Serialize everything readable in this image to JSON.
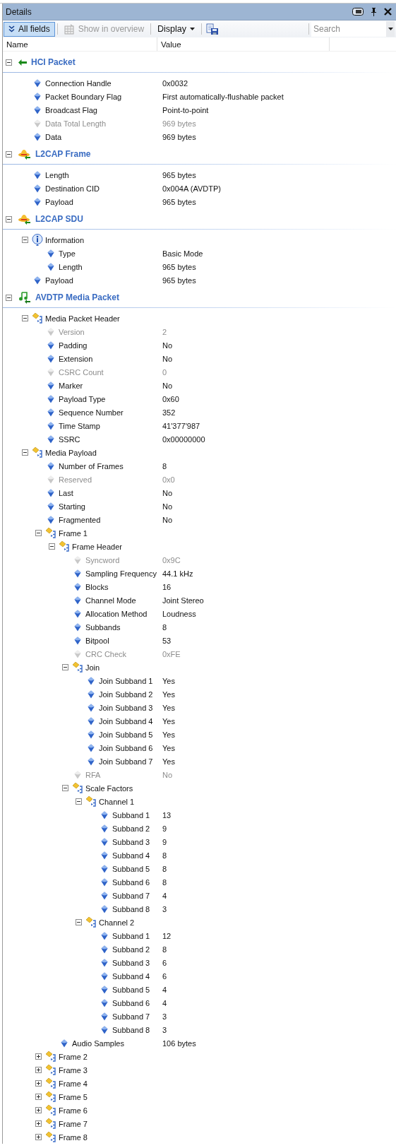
{
  "window": {
    "title": "Details"
  },
  "toolbar": {
    "all_fields": {
      "label": "All fields",
      "selected": true
    },
    "show_in_overview": {
      "label": "Show in overview",
      "disabled": true
    },
    "display": {
      "label": "Display"
    },
    "search": {
      "placeholder": "Search"
    }
  },
  "columns": [
    "Name",
    "Value"
  ],
  "sections": [
    {
      "title": "HCI Packet",
      "expanded": true,
      "children": [
        {
          "kind": "field",
          "name": "Connection Handle",
          "value": "0x0032",
          "disabled": false
        },
        {
          "kind": "field",
          "name": "Packet Boundary Flag",
          "value": "First automatically-flushable packet",
          "disabled": false
        },
        {
          "kind": "field",
          "name": "Broadcast Flag",
          "value": "Point-to-point",
          "disabled": false
        },
        {
          "kind": "field",
          "name": "Data Total Length",
          "value": "969 bytes",
          "disabled": true
        },
        {
          "kind": "field",
          "name": "Data",
          "value": "969 bytes",
          "disabled": false
        }
      ]
    },
    {
      "title": "L2CAP Frame",
      "expanded": true,
      "children": [
        {
          "kind": "field",
          "name": "Length",
          "value": "965 bytes",
          "disabled": false
        },
        {
          "kind": "field",
          "name": "Destination CID",
          "value": "0x004A (AVDTP)",
          "disabled": false
        },
        {
          "kind": "field",
          "name": "Payload",
          "value": "965 bytes",
          "disabled": false
        }
      ]
    },
    {
      "title": "L2CAP SDU",
      "expanded": true,
      "children": [
        {
          "kind": "info",
          "name": "Information",
          "expanded": true,
          "children": [
            {
              "kind": "field",
              "name": "Type",
              "value": "Basic Mode",
              "disabled": false
            },
            {
              "kind": "field",
              "name": "Length",
              "value": "965 bytes",
              "disabled": false
            }
          ]
        },
        {
          "kind": "field",
          "name": "Payload",
          "value": "965 bytes",
          "disabled": false
        }
      ]
    },
    {
      "title": "AVDTP Media Packet",
      "expanded": true,
      "children": [
        {
          "kind": "group",
          "name": "Media Packet Header",
          "expanded": true,
          "children": [
            {
              "kind": "field",
              "name": "Version",
              "value": "2",
              "disabled": true
            },
            {
              "kind": "field",
              "name": "Padding",
              "value": "No",
              "disabled": false
            },
            {
              "kind": "field",
              "name": "Extension",
              "value": "No",
              "disabled": false
            },
            {
              "kind": "field",
              "name": "CSRC Count",
              "value": "0",
              "disabled": true
            },
            {
              "kind": "field",
              "name": "Marker",
              "value": "No",
              "disabled": false
            },
            {
              "kind": "field",
              "name": "Payload Type",
              "value": "0x60",
              "disabled": false
            },
            {
              "kind": "field",
              "name": "Sequence Number",
              "value": "352",
              "disabled": false
            },
            {
              "kind": "field",
              "name": "Time Stamp",
              "value": "41'377'987",
              "disabled": false
            },
            {
              "kind": "field",
              "name": "SSRC",
              "value": "0x00000000",
              "disabled": false
            }
          ]
        },
        {
          "kind": "group",
          "name": "Media Payload",
          "expanded": true,
          "children": [
            {
              "kind": "field",
              "name": "Number of Frames",
              "value": "8",
              "disabled": false
            },
            {
              "kind": "field",
              "name": "Reserved",
              "value": "0x0",
              "disabled": true
            },
            {
              "kind": "field",
              "name": "Last",
              "value": "No",
              "disabled": false
            },
            {
              "kind": "field",
              "name": "Starting",
              "value": "No",
              "disabled": false
            },
            {
              "kind": "field",
              "name": "Fragmented",
              "value": "No",
              "disabled": false
            },
            {
              "kind": "group",
              "name": "Frame 1",
              "expanded": true,
              "children": [
                {
                  "kind": "group",
                  "name": "Frame Header",
                  "expanded": true,
                  "children": [
                    {
                      "kind": "field",
                      "name": "Syncword",
                      "value": "0x9C",
                      "disabled": true
                    },
                    {
                      "kind": "field",
                      "name": "Sampling Frequency",
                      "value": "44.1 kHz",
                      "disabled": false
                    },
                    {
                      "kind": "field",
                      "name": "Blocks",
                      "value": "16",
                      "disabled": false
                    },
                    {
                      "kind": "field",
                      "name": "Channel Mode",
                      "value": "Joint Stereo",
                      "disabled": false
                    },
                    {
                      "kind": "field",
                      "name": "Allocation Method",
                      "value": "Loudness",
                      "disabled": false
                    },
                    {
                      "kind": "field",
                      "name": "Subbands",
                      "value": "8",
                      "disabled": false
                    },
                    {
                      "kind": "field",
                      "name": "Bitpool",
                      "value": "53",
                      "disabled": false
                    },
                    {
                      "kind": "field",
                      "name": "CRC Check",
                      "value": "0xFE",
                      "disabled": true
                    },
                    {
                      "kind": "group",
                      "name": "Join",
                      "expanded": true,
                      "children": [
                        {
                          "kind": "field",
                          "name": "Join Subband 1",
                          "value": "Yes",
                          "disabled": false
                        },
                        {
                          "kind": "field",
                          "name": "Join Subband 2",
                          "value": "Yes",
                          "disabled": false
                        },
                        {
                          "kind": "field",
                          "name": "Join Subband 3",
                          "value": "Yes",
                          "disabled": false
                        },
                        {
                          "kind": "field",
                          "name": "Join Subband 4",
                          "value": "Yes",
                          "disabled": false
                        },
                        {
                          "kind": "field",
                          "name": "Join Subband 5",
                          "value": "Yes",
                          "disabled": false
                        },
                        {
                          "kind": "field",
                          "name": "Join Subband 6",
                          "value": "Yes",
                          "disabled": false
                        },
                        {
                          "kind": "field",
                          "name": "Join Subband 7",
                          "value": "Yes",
                          "disabled": false
                        }
                      ]
                    },
                    {
                      "kind": "field",
                      "name": "RFA",
                      "value": "No",
                      "disabled": true
                    },
                    {
                      "kind": "group",
                      "name": "Scale Factors",
                      "expanded": true,
                      "children": [
                        {
                          "kind": "group",
                          "name": "Channel 1",
                          "expanded": true,
                          "children": [
                            {
                              "kind": "field",
                              "name": "Subband 1",
                              "value": "13",
                              "disabled": false
                            },
                            {
                              "kind": "field",
                              "name": "Subband 2",
                              "value": "9",
                              "disabled": false
                            },
                            {
                              "kind": "field",
                              "name": "Subband 3",
                              "value": "9",
                              "disabled": false
                            },
                            {
                              "kind": "field",
                              "name": "Subband 4",
                              "value": "8",
                              "disabled": false
                            },
                            {
                              "kind": "field",
                              "name": "Subband 5",
                              "value": "8",
                              "disabled": false
                            },
                            {
                              "kind": "field",
                              "name": "Subband 6",
                              "value": "8",
                              "disabled": false
                            },
                            {
                              "kind": "field",
                              "name": "Subband 7",
                              "value": "4",
                              "disabled": false
                            },
                            {
                              "kind": "field",
                              "name": "Subband 8",
                              "value": "3",
                              "disabled": false
                            }
                          ]
                        },
                        {
                          "kind": "group",
                          "name": "Channel 2",
                          "expanded": true,
                          "children": [
                            {
                              "kind": "field",
                              "name": "Subband 1",
                              "value": "12",
                              "disabled": false
                            },
                            {
                              "kind": "field",
                              "name": "Subband 2",
                              "value": "8",
                              "disabled": false
                            },
                            {
                              "kind": "field",
                              "name": "Subband 3",
                              "value": "6",
                              "disabled": false
                            },
                            {
                              "kind": "field",
                              "name": "Subband 4",
                              "value": "6",
                              "disabled": false
                            },
                            {
                              "kind": "field",
                              "name": "Subband 5",
                              "value": "4",
                              "disabled": false
                            },
                            {
                              "kind": "field",
                              "name": "Subband 6",
                              "value": "4",
                              "disabled": false
                            },
                            {
                              "kind": "field",
                              "name": "Subband 7",
                              "value": "3",
                              "disabled": false
                            },
                            {
                              "kind": "field",
                              "name": "Subband 8",
                              "value": "3",
                              "disabled": false
                            }
                          ]
                        }
                      ]
                    }
                  ]
                },
                {
                  "kind": "field",
                  "name": "Audio Samples",
                  "value": "106 bytes",
                  "disabled": false
                }
              ]
            },
            {
              "kind": "group",
              "name": "Frame 2",
              "expanded": false
            },
            {
              "kind": "group",
              "name": "Frame 3",
              "expanded": false
            },
            {
              "kind": "group",
              "name": "Frame 4",
              "expanded": false
            },
            {
              "kind": "group",
              "name": "Frame 5",
              "expanded": false
            },
            {
              "kind": "group",
              "name": "Frame 6",
              "expanded": false
            },
            {
              "kind": "group",
              "name": "Frame 7",
              "expanded": false
            },
            {
              "kind": "group",
              "name": "Frame 8",
              "expanded": false
            }
          ]
        }
      ]
    }
  ]
}
